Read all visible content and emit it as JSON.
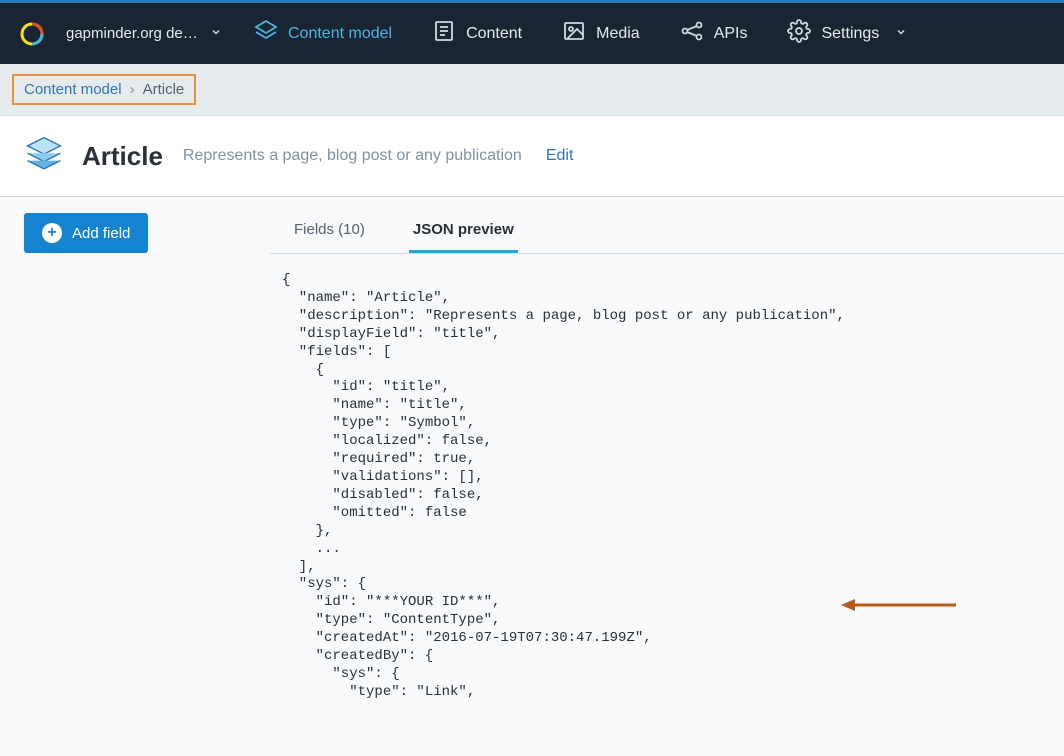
{
  "topbar": {
    "space_name": "gapminder.org develo…",
    "nav": {
      "content_model": "Content model",
      "content": "Content",
      "media": "Media",
      "apis": "APIs",
      "settings": "Settings"
    }
  },
  "breadcrumb": {
    "root": "Content model",
    "current": "Article"
  },
  "header": {
    "title": "Article",
    "description": "Represents a page, blog post or any publication",
    "edit": "Edit"
  },
  "sidebar": {
    "add_field": "Add field"
  },
  "tabs": {
    "fields": "Fields (10)",
    "json": "JSON preview"
  },
  "json_preview": "{\n  \"name\": \"Article\",\n  \"description\": \"Represents a page, blog post or any publication\",\n  \"displayField\": \"title\",\n  \"fields\": [\n    {\n      \"id\": \"title\",\n      \"name\": \"title\",\n      \"type\": \"Symbol\",\n      \"localized\": false,\n      \"required\": true,\n      \"validations\": [],\n      \"disabled\": false,\n      \"omitted\": false\n    },\n    ...\n  ],\n  \"sys\": {\n    \"id\": \"***YOUR ID***\",\n    \"type\": \"ContentType\",\n    \"createdAt\": \"2016-07-19T07:30:47.199Z\",\n    \"createdBy\": {\n      \"sys\": {\n        \"type\": \"Link\","
}
